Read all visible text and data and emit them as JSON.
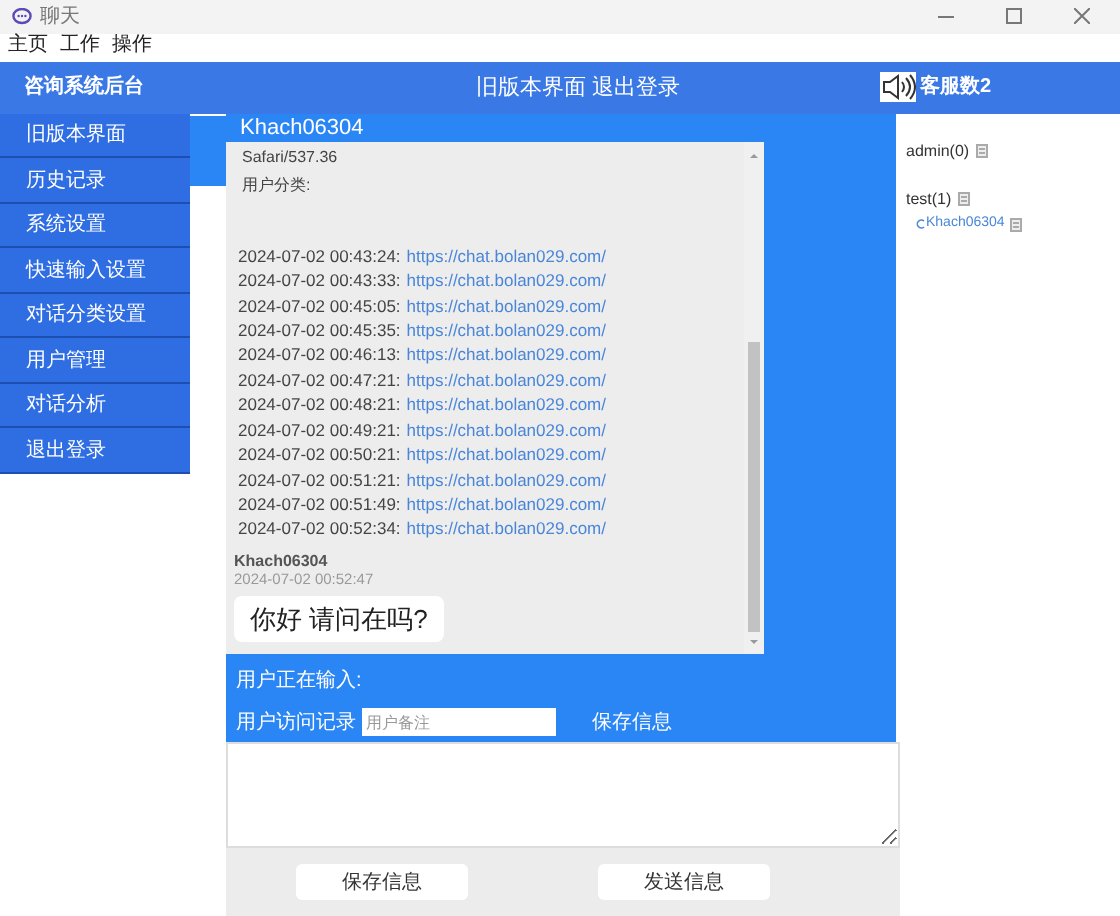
{
  "window": {
    "title": "聊天"
  },
  "menu": [
    "主页",
    "工作",
    "操作"
  ],
  "header": {
    "brand": "咨询系统后台",
    "links": [
      "旧版本界面",
      "退出登录"
    ],
    "agents": "客服数2"
  },
  "sidebar": {
    "items": [
      "旧版本界面",
      "历史记录",
      "系统设置",
      "快速输入设置",
      "对话分类设置",
      "用户管理",
      "对话分析",
      "退出登录"
    ]
  },
  "chat": {
    "title": "Khach06304",
    "info": [
      "Safari/537.36",
      "用户分类:"
    ],
    "visits": [
      {
        "time": "2024-07-02 00:43:24:",
        "url": "https://chat.bolan029.com/"
      },
      {
        "time": "2024-07-02 00:43:33:",
        "url": "https://chat.bolan029.com/"
      },
      {
        "time": "2024-07-02 00:45:05:",
        "url": "https://chat.bolan029.com/"
      },
      {
        "time": "2024-07-02 00:45:35:",
        "url": "https://chat.bolan029.com/"
      },
      {
        "time": "2024-07-02 00:46:13:",
        "url": "https://chat.bolan029.com/"
      },
      {
        "time": "2024-07-02 00:47:21:",
        "url": "https://chat.bolan029.com/"
      },
      {
        "time": "2024-07-02 00:48:21:",
        "url": "https://chat.bolan029.com/"
      },
      {
        "time": "2024-07-02 00:49:21:",
        "url": "https://chat.bolan029.com/"
      },
      {
        "time": "2024-07-02 00:50:21:",
        "url": "https://chat.bolan029.com/"
      },
      {
        "time": "2024-07-02 00:51:21:",
        "url": "https://chat.bolan029.com/"
      },
      {
        "time": "2024-07-02 00:51:49:",
        "url": "https://chat.bolan029.com/"
      },
      {
        "time": "2024-07-02 00:52:34:",
        "url": "https://chat.bolan029.com/"
      }
    ],
    "message": {
      "sender": "Khach06304",
      "time": "2024-07-02 00:52:47",
      "text": "你好 请问在吗?"
    },
    "typing": "用户正在输入:",
    "record_label": "用户访问记录",
    "note": {
      "placeholder": "用户备注"
    },
    "save_link": "保存信息"
  },
  "users": [
    {
      "name": "admin(0)"
    },
    {
      "name": "test(1)",
      "children": [
        {
          "name": "Khach06304"
        }
      ]
    }
  ],
  "buttons": [
    "保存信息",
    "发送信息"
  ]
}
